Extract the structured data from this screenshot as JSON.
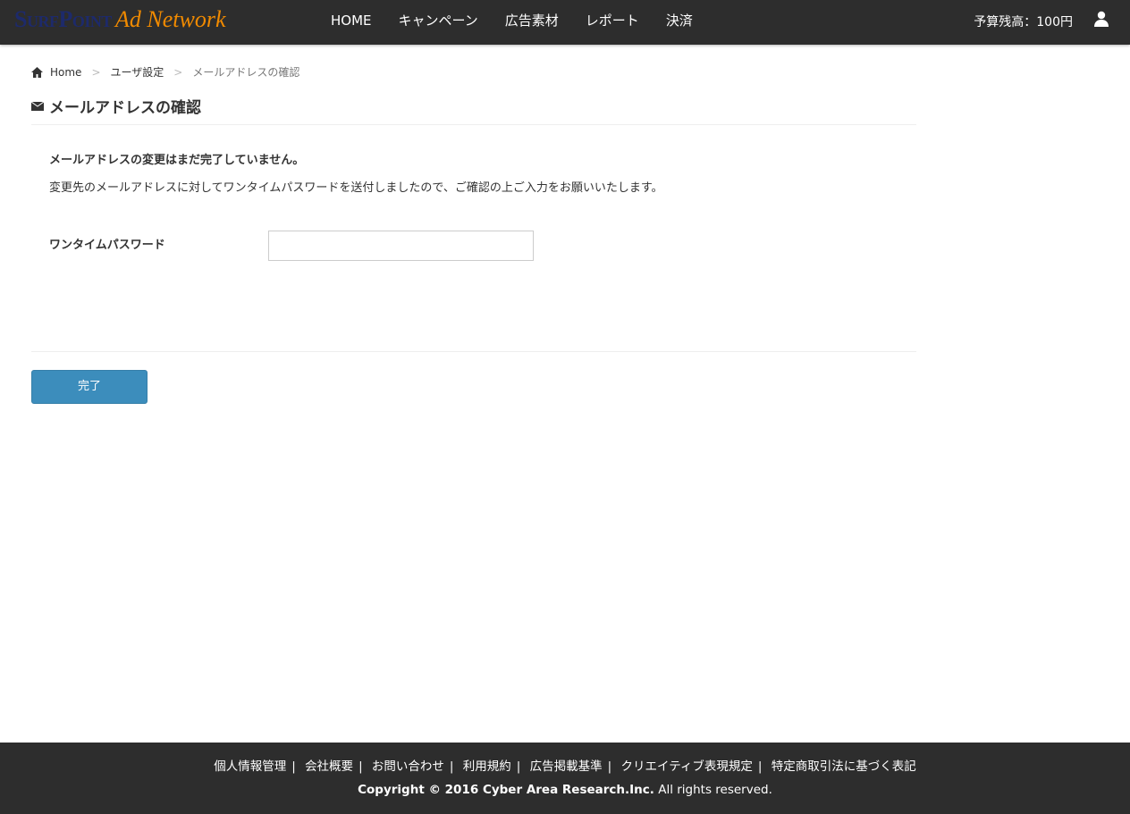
{
  "header": {
    "logo_part1": "SurfPoint",
    "logo_part2": "Ad Network",
    "menu": [
      "HOME",
      "キャンペーン",
      "広告素材",
      "レポート",
      "決済"
    ],
    "budget": "予算残高：100円"
  },
  "breadcrumb": [
    "Home",
    "ユーザ設定",
    "メールアドレスの確認"
  ],
  "page": {
    "title": "メールアドレスの確認",
    "message_bold": "メールアドレスの変更はまだ完了していません。",
    "message": "変更先のメールアドレスに対してワンタイムパスワードを送付しましたので、ご確認の上ご入力をお願いいたします。",
    "otp_label": "ワンタイムパスワード",
    "otp_value": "",
    "submit": "完了"
  },
  "footer": {
    "links": [
      "個人情報管理",
      "会社概要",
      "お問い合わせ",
      "利用規約",
      "広告掲載基準",
      "クリエイティブ表現規定",
      "特定商取引法に基づく表記"
    ],
    "copyright_bold": "Copyright © 2016 Cyber Area Research.Inc.",
    "copyright_rest": " All rights reserved."
  }
}
